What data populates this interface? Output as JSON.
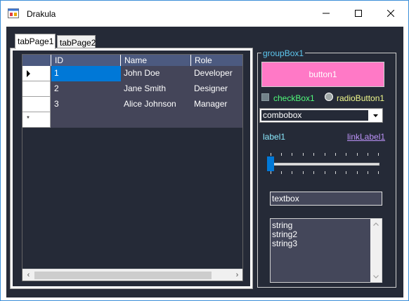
{
  "window": {
    "title": "Drakula",
    "icon": "winforms-app-icon",
    "controls": [
      "minimize-icon",
      "maximize-icon",
      "close-icon"
    ]
  },
  "tabs": [
    {
      "label": "tabPage1",
      "active": true
    },
    {
      "label": "tabPage2",
      "active": false
    }
  ],
  "grid": {
    "columns": [
      "ID",
      "Name",
      "Role"
    ],
    "rows": [
      {
        "id": "1",
        "name": "John Doe",
        "role": "Developer",
        "selected": true,
        "marker": "current-row-arrow-icon"
      },
      {
        "id": "2",
        "name": "Jane Smith",
        "role": "Designer"
      },
      {
        "id": "3",
        "name": "Alice Johnson",
        "role": "Manager"
      }
    ],
    "new_row_marker": "*",
    "scroll_left": "‹",
    "scroll_right": "›"
  },
  "group": {
    "title": "groupBox1",
    "button_label": "button1",
    "checkbox_label": "checkBox1",
    "radio_label": "radioButton1",
    "combo_value": "combobox",
    "label": "label1",
    "link": "linkLabel1",
    "trackbar_value": 0,
    "textbox_value": "textbox",
    "list_items": [
      "string",
      "string2",
      "string3"
    ]
  },
  "colors": {
    "background": "#252a37",
    "accent": "#0078d7",
    "button": "#ff79c6",
    "checkbox_text": "#50fa7b",
    "radio_text": "#f1fa8c",
    "label_text": "#8be9fd",
    "link_text": "#bd93f9",
    "group_title": "#5ec8f0"
  }
}
